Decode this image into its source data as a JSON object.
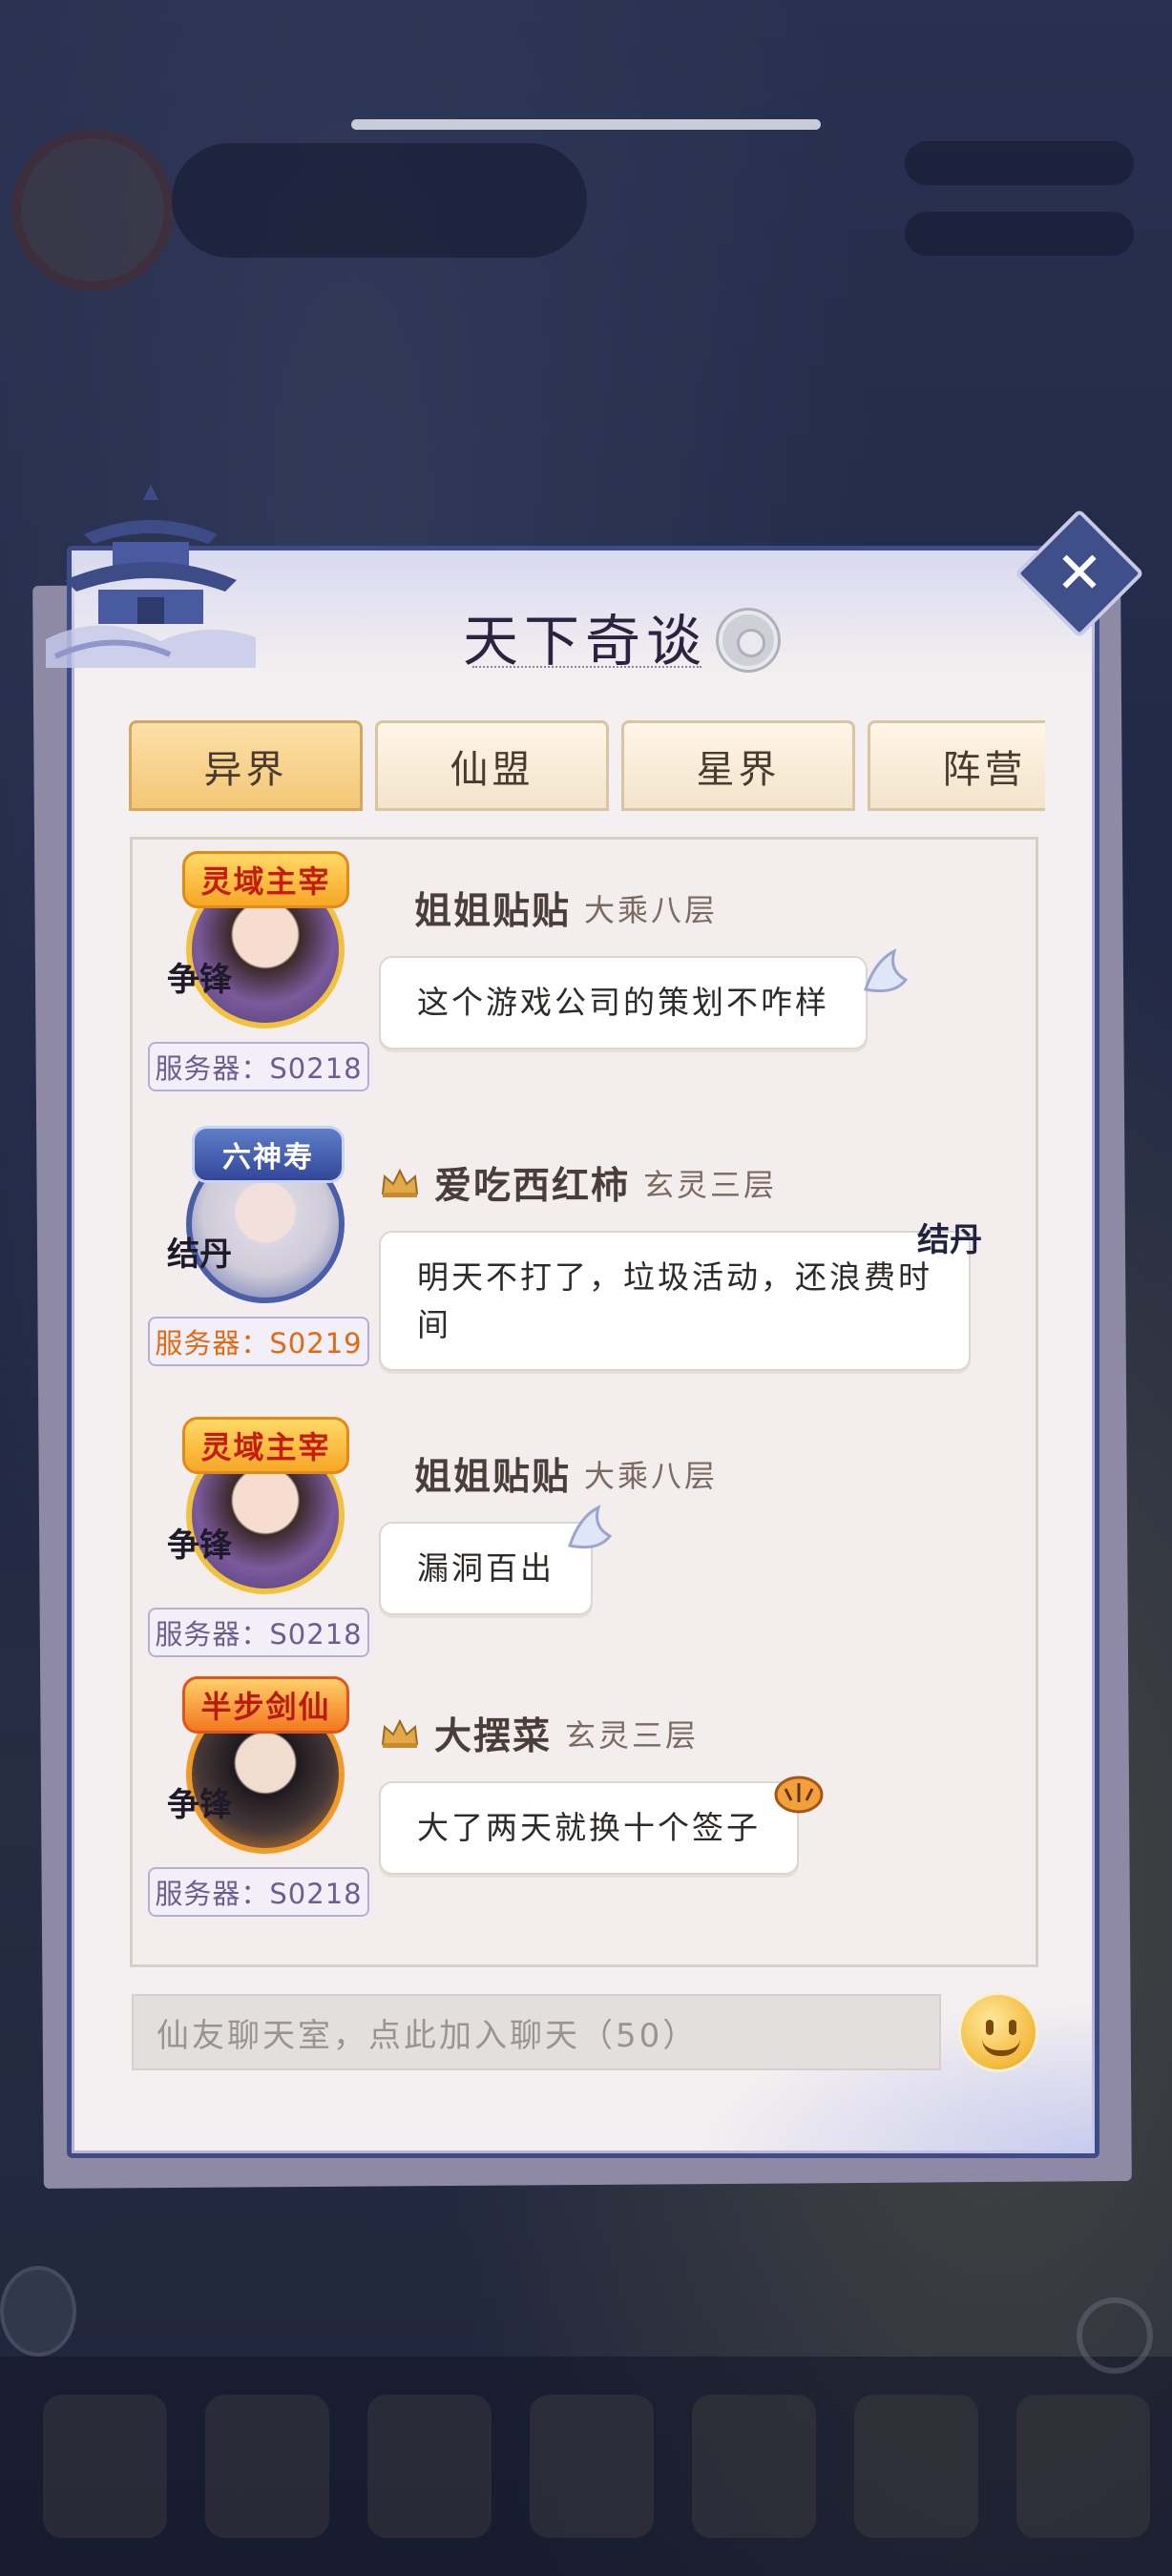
{
  "panel": {
    "title": "天下奇谈",
    "close_label": "✕"
  },
  "tabs": [
    {
      "label": "异界",
      "active": true
    },
    {
      "label": "仙盟",
      "active": false
    },
    {
      "label": "星界",
      "active": false
    },
    {
      "label": "阵营",
      "active": false
    }
  ],
  "messages": [
    {
      "title_badge": "灵域主宰",
      "calligraphy": "争锋",
      "server": "服务器：S0218",
      "name": "姐姐贴贴",
      "rank": "大乘八层",
      "has_crown": false,
      "text": "这个游戏公司的策划不咋样"
    },
    {
      "title_badge": "六神寿",
      "calligraphy": "结丹",
      "server": "服务器：S0219",
      "name": "爱吃西红柿",
      "rank": "玄灵三层",
      "has_crown": true,
      "text": "明天不打了，垃圾活动，还浪费时间",
      "bubble_deco": "结丹"
    },
    {
      "title_badge": "灵域主宰",
      "calligraphy": "争锋",
      "server": "服务器：S0218",
      "name": "姐姐贴贴",
      "rank": "大乘八层",
      "has_crown": false,
      "text": "漏洞百出"
    },
    {
      "title_badge": "半步剑仙",
      "calligraphy": "争锋",
      "server": "服务器：S0218",
      "name": "大摆菜",
      "rank": "玄灵三层",
      "has_crown": true,
      "text": "大了两天就换十个签子"
    }
  ],
  "chat_input": {
    "placeholder": "仙友聊天室，点此加入聊天（50）"
  },
  "colors": {
    "panel_border": "#3d4c86",
    "tab_active": "#f4c776",
    "server_text": "#6a5f90",
    "server_text_alt": "#e06a10"
  }
}
